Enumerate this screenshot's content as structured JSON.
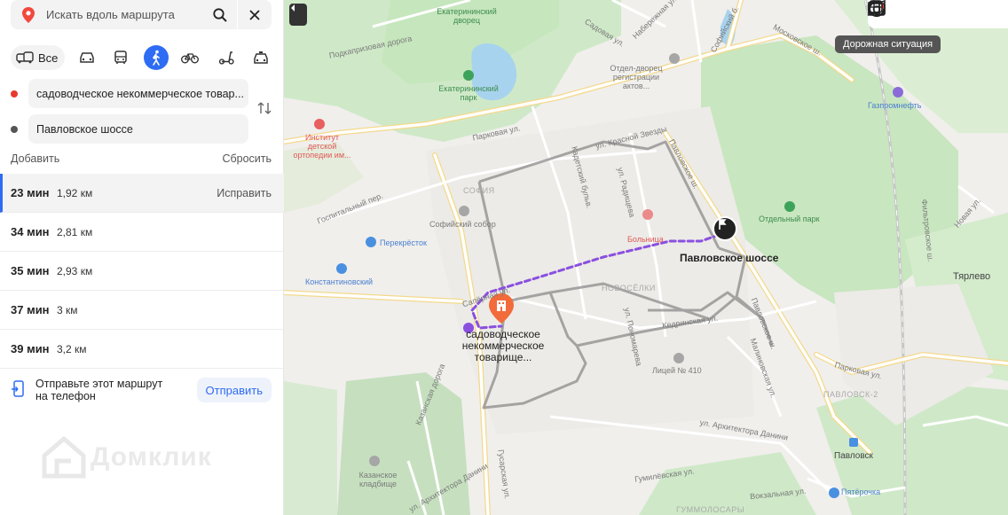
{
  "search": {
    "placeholder": "Искать вдоль маршрута"
  },
  "modes": {
    "all_label": "Все"
  },
  "points": {
    "from": "садоводческое некоммерческое товар...",
    "to": "Павловское шоссе"
  },
  "actions": {
    "add": "Добавить",
    "reset": "Сбросить"
  },
  "routes": [
    {
      "time": "23 мин",
      "distance": "1,92 км",
      "action": "Исправить"
    },
    {
      "time": "34 мин",
      "distance": "2,81 км"
    },
    {
      "time": "35 мин",
      "distance": "2,93 км"
    },
    {
      "time": "37 мин",
      "distance": "3 км"
    },
    {
      "time": "39 мин",
      "distance": "3,2 км"
    }
  ],
  "send": {
    "text": "Отправьте этот маршрут на телефон",
    "button": "Отправить"
  },
  "watermark": "Домклик",
  "map": {
    "tooltip": "Дорожная ситуация",
    "labels": {
      "ekaterininsky_palace": "Екатерининский дворец",
      "ekaterininsky_park": "Екатерининский парк",
      "podkapriznaya": "Подкапризовая дорога",
      "parkovaya": "Парковая ул.",
      "institute": "Институт детской ортопедии им...",
      "sofia": "СОФИЯ",
      "sofia_cathedral": "Софийский собор",
      "gospitalny": "Госпитальный пер.",
      "perekrestok": "Перекрёсток",
      "konstantinovsky": "Константиновский",
      "saperny": "Сапёрная ул.",
      "kadetsky": "Кадетский бульв.",
      "radishcheva": "ул. Радищева",
      "krasnoy_zvezdy": "ул. Красной Звезды",
      "bolnitsa": "Больница",
      "pavlovskoe_shosse_road": "Павловское ш.",
      "pavlovskoe_shosse_road_2": "Павловское ш.",
      "pavlovskoe_shosse": "Павловское шоссе",
      "otdelny_park": "Отдельный парк",
      "gazpromneft": "Газпромнефть",
      "otdel_dvorets": "Отдел-дворец регистрации актов...",
      "sofiyskiy_bulv": "Софийский б.",
      "moskovskoe_sh": "Московское ш.",
      "sadovaya": "Садовая ул.",
      "naberezhnaya": "Набережная ул.",
      "novoselki": "НОВОСЁЛКИ",
      "ponomareva": "ул. Пономарева",
      "kedrinskaya": "Кедринская ул.",
      "litsey": "Лицей № 410",
      "malinovskaya": "Малиновская ул.",
      "destination": "садоводческое некоммерческое товарище...",
      "kazanskaya_doroga": "Казанская дорога",
      "kazanskoe": "Казанское кладбище",
      "gusarskaya": "Гусарская ул.",
      "danini": "ул. Архитектора Данини",
      "danini2": "ул. Архитектора Данини",
      "gumilevskaya": "Гумилёвская ул.",
      "gumolosary": "ГУММОЛОСАРЫ",
      "vokzalnaya": "Вокзальная ул.",
      "pavlovsk": "Павловск",
      "pavlovsk2": "ПАВЛОВСК-2",
      "pyaterochka": "Пятёрочка",
      "parkovaya2": "Парковая ул.",
      "tyarlevo": "Тярлево",
      "novaya": "Новая ул.",
      "filtrovskoe": "Фильтровское ш."
    }
  },
  "colors": {
    "accent": "#2e6cf3",
    "route_walk": "#8a4fe0",
    "start": "#e8392f",
    "end": "#555555"
  }
}
